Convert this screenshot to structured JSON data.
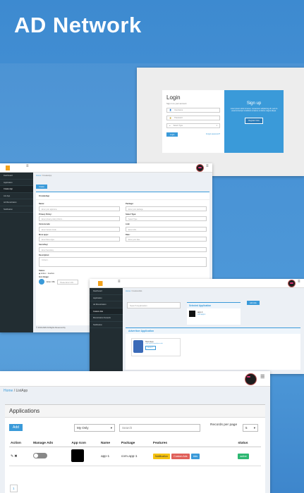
{
  "headline": "AD Network",
  "login": {
    "title": "Login",
    "subtitle": "Sign in to your account",
    "username_placeholder": "Username",
    "password_placeholder": "Password",
    "type_placeholder": "Select Type",
    "login_button": "Login",
    "forgot": "Forgot password?",
    "signup_title": "Sign up",
    "signup_text": "Lorem ipsum dolor sit amet, consectetur adipisicing elit, sed do eiusmod tempor incididunt ut labore et dolore magna aliqua.",
    "register_button": "Register Now"
  },
  "create": {
    "breadcrumb_home": "Home",
    "breadcrumb_page": "CreateApp",
    "add_button": "Create",
    "box_title": "CreateApp",
    "sidebar": [
      "Dashboard",
      "Application",
      "Create App",
      "List App",
      "Ad Monetization",
      "Notification"
    ],
    "fields": [
      {
        "label": "Name:",
        "placeholder": "Enter your appname"
      },
      {
        "label": "Package:",
        "placeholder": "Enter your package"
      },
      {
        "label": "Privacy Policy:",
        "placeholder": "Enter privacy policy (Inform..."
      },
      {
        "label": "Select Type:",
        "placeholder": "Select Type"
      },
      {
        "label": "Versioncode:",
        "placeholder": "Enter Version Code"
      },
      {
        "label": "Link:",
        "placeholder": "Enter URL"
      },
      {
        "label": "More apps:",
        "placeholder": "Enter More Apps"
      },
      {
        "label": "Date:",
        "placeholder": "Enter your date"
      },
      {
        "label": "Secrethey:",
        "placeholder": "Enter Secretkey"
      }
    ],
    "description_label": "Description:",
    "description_placeholder": "Content...",
    "status_label": "Status:",
    "status_active": "Active",
    "status_inactive": "Inactive",
    "monet_label": "Monet",
    "icon_label": "Icon Image:",
    "enter_url": "Enter URL",
    "please_enter": "Please Enter URL",
    "footer": "© 2019-2020 All Rights Reserved by"
  },
  "custom": {
    "breadcrumb_home": "Home",
    "breadcrumb_page": "CustomAds",
    "search_placeholder": "Search Application",
    "selected_title": "Selected Application",
    "selected_app_name": "app-1",
    "selected_app_pkg": "com.app-1",
    "select_button": "Add Ads",
    "adv_title": "Advertiser Application",
    "adv_app_name": "Test App",
    "adv_app_pkg": "com.nexus.anywhere.ads",
    "adv_select": "SELECT",
    "sidebar": [
      "Dashboard",
      "Application",
      "Ad Monetization",
      "Custom Ads",
      "Monetization Network",
      "Notification"
    ]
  },
  "listapp": {
    "breadcrumb_home": "Home",
    "breadcrumb_page": "ListApp",
    "panel_title": "Applications",
    "add_button": "Add",
    "filter_value": "My Only",
    "search_placeholder": "Search",
    "records_label": "Records per page",
    "records_value": "5",
    "columns": [
      "Action",
      "Manage Ads",
      "App Icon",
      "Name",
      "Package",
      "Features",
      "status"
    ],
    "rows": [
      {
        "name": "app-1",
        "package": "com.app-1",
        "features": [
          "Notification",
          "Custom Ads",
          "Ads"
        ],
        "status": "active"
      }
    ],
    "page": "1"
  },
  "colors": {
    "accent": "#3a9ad9",
    "sidebar": "#222d32",
    "yellow": "#f5c211",
    "red": "#e0605a",
    "green": "#2eb872"
  }
}
